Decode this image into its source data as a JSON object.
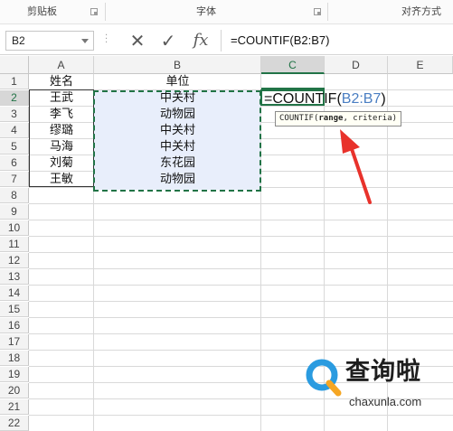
{
  "ribbon": {
    "groups": [
      {
        "label": "剪贴板"
      },
      {
        "label": "字体"
      },
      {
        "label": "对齐方式"
      }
    ]
  },
  "formula_bar": {
    "name_box": "B2",
    "formula": "=COUNTIF(B2:B7)"
  },
  "sheet": {
    "columns": [
      "A",
      "B",
      "C",
      "D",
      "E"
    ],
    "selected_column": "C",
    "rows": [
      "1",
      "2",
      "3",
      "4",
      "5",
      "6",
      "7",
      "8",
      "9",
      "10",
      "11",
      "12",
      "13",
      "14",
      "15",
      "16",
      "17",
      "18",
      "19",
      "20",
      "21",
      "22"
    ],
    "selected_row": "2",
    "header_row": {
      "a": "姓名",
      "b": "单位"
    },
    "data": [
      {
        "name": "王武",
        "unit": "中关村"
      },
      {
        "name": "李飞",
        "unit": "动物园"
      },
      {
        "name": "缪璐",
        "unit": "中关村"
      },
      {
        "name": "马海",
        "unit": "中关村"
      },
      {
        "name": "刘菊",
        "unit": "东花园"
      },
      {
        "name": "王敏",
        "unit": "动物园"
      }
    ],
    "editing_cell": {
      "prefix": "=COUNTIF(",
      "range": "B2:B7",
      "suffix": ")"
    },
    "tooltip": {
      "func": "COUNTIF",
      "open": "(",
      "arg1": "range",
      "rest": ", criteria)"
    }
  },
  "annotation": {
    "arrow_color": "#e8322b"
  },
  "watermark": {
    "title": "查询啦",
    "url": "chaxunla.com",
    "accent": "#2a9be0",
    "accent2": "#f5a623"
  }
}
